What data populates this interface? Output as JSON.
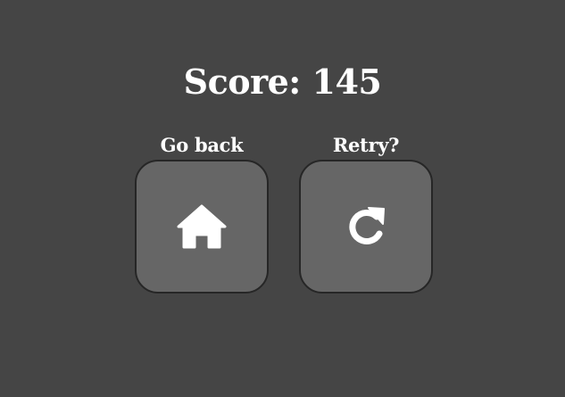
{
  "score": {
    "text": "Score: 145"
  },
  "options": {
    "back": {
      "label": "Go back",
      "icon": "home-icon"
    },
    "retry": {
      "label": "Retry?",
      "icon": "retry-icon"
    }
  },
  "colors": {
    "background": "#454545",
    "button_fill": "#666666",
    "button_border": "#262626",
    "text": "#ffffff"
  }
}
